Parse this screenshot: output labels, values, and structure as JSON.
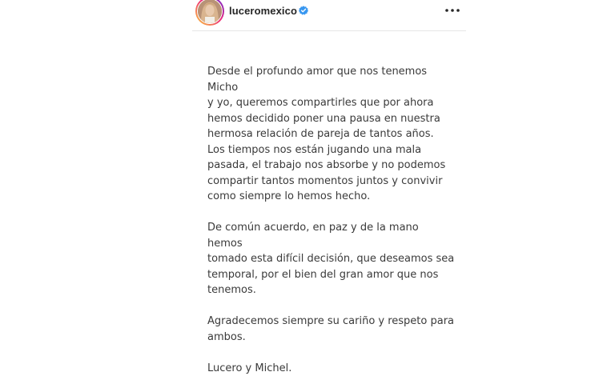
{
  "post": {
    "username": "luceromexico",
    "icons": {
      "avatar": "profile-avatar",
      "verified": "verified-badge-icon",
      "more": "more-options-icon"
    },
    "colors": {
      "verified": "#3897f0",
      "text": "#3a3a3a"
    },
    "paragraphs": [
      "Desde el profundo amor que nos tenemos Micho\ny yo, queremos compartirles que por ahora\nhemos decidido poner una pausa en nuestra\nhermosa relación de pareja de tantos años.\nLos tiempos nos están jugando una mala\npasada, el trabajo nos absorbe y no podemos\ncompartir tantos momentos juntos y convivir\ncomo siempre lo hemos hecho.",
      "De común acuerdo, en paz y de la mano hemos\ntomado esta difícil decisión, que deseamos sea\ntemporal, por el bien del gran amor que nos\ntenemos.",
      "Agradecemos siempre su cariño y respeto para\nambos.",
      "Lucero y Michel."
    ]
  }
}
